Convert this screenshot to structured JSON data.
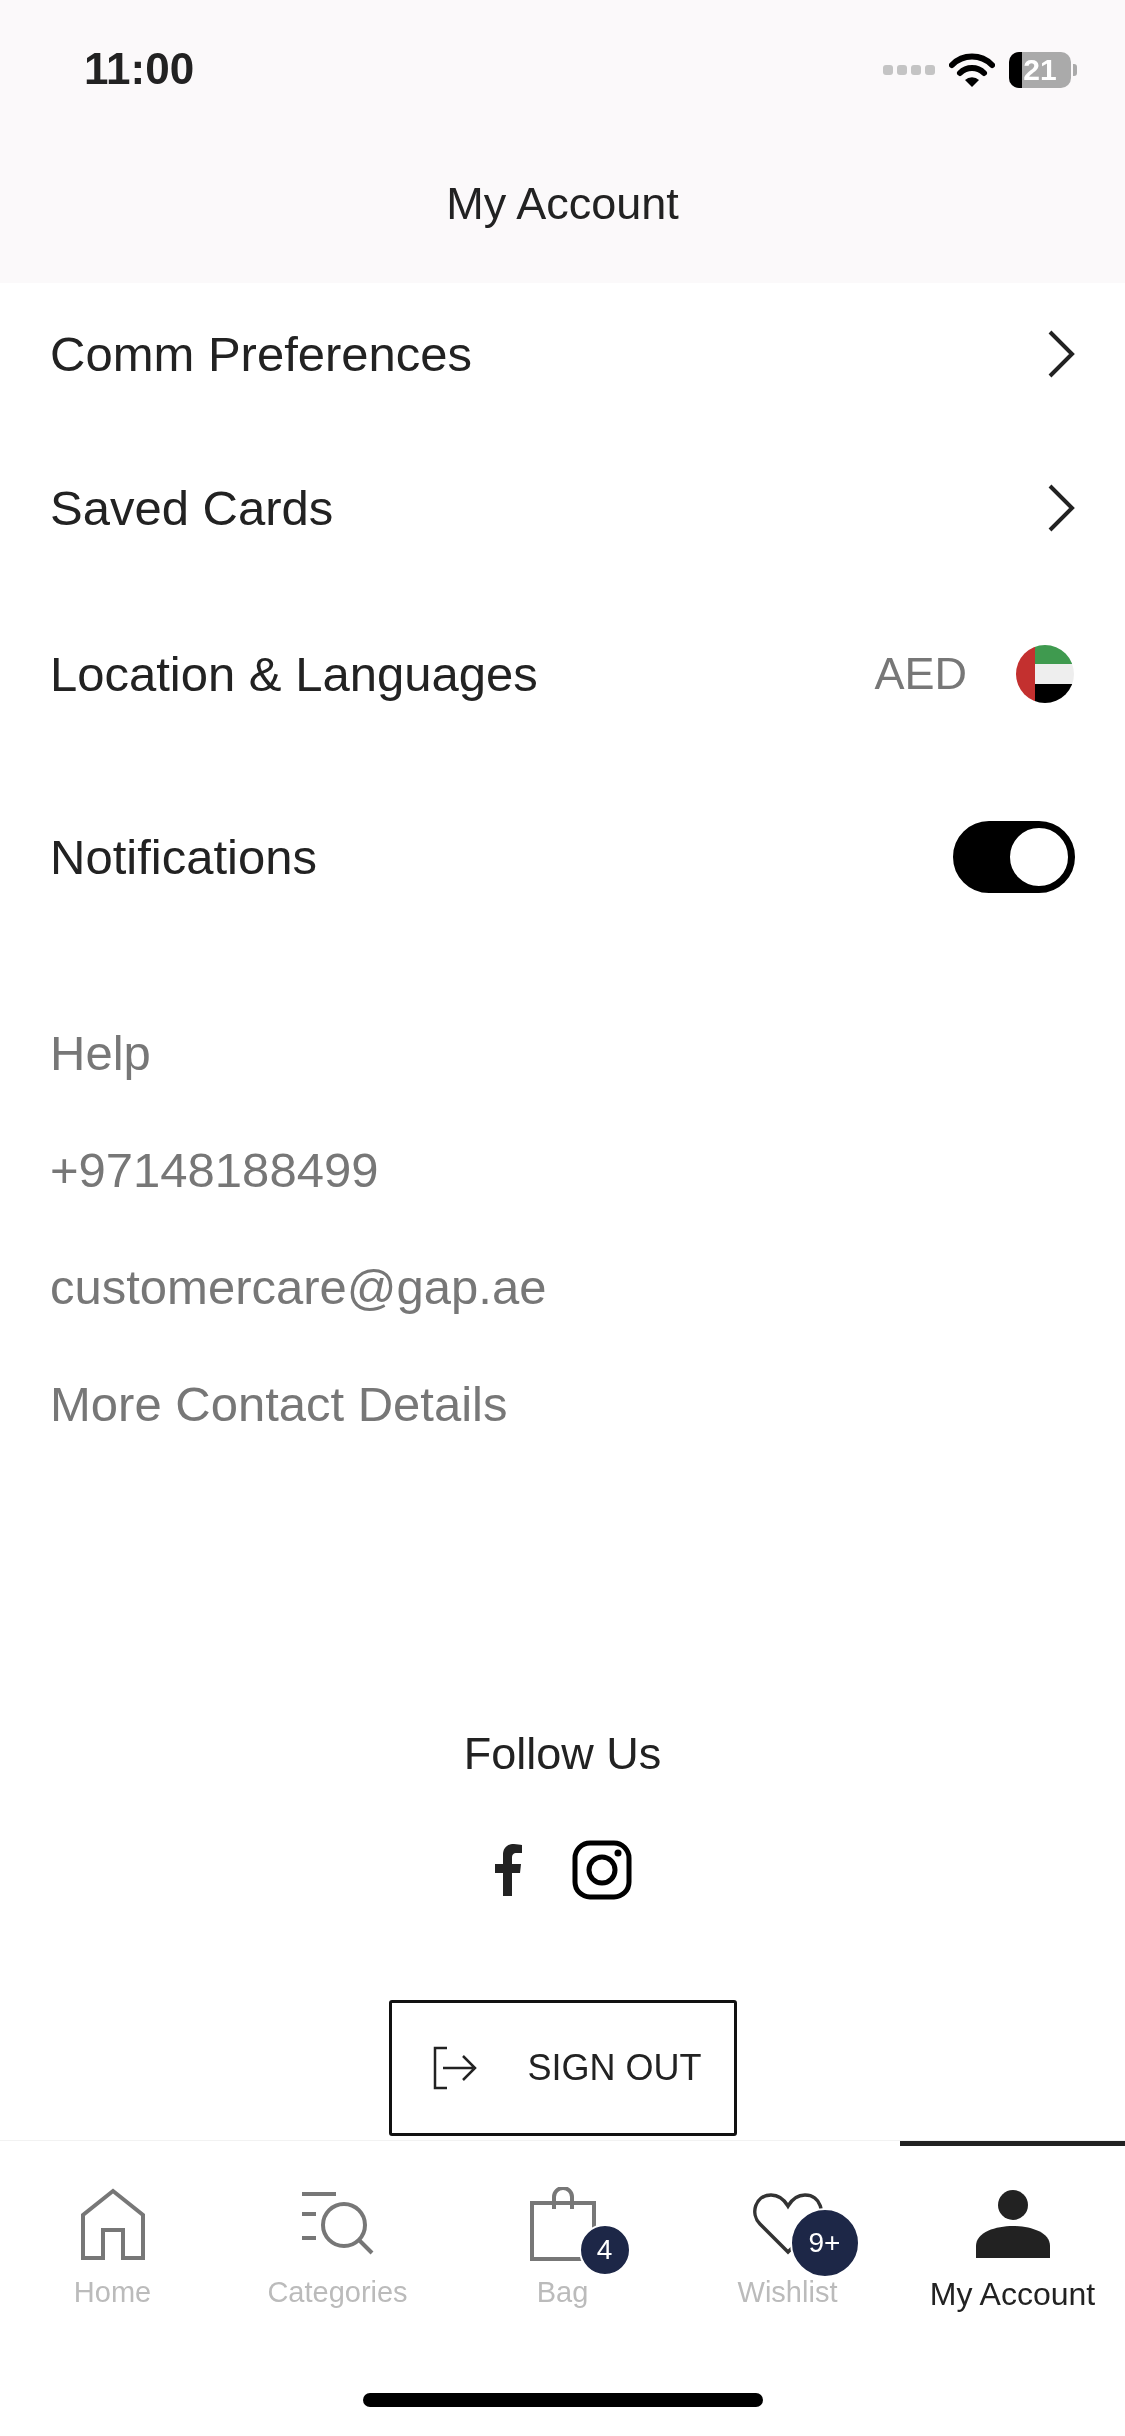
{
  "status_bar": {
    "time": "11:00",
    "battery": "21"
  },
  "header": {
    "title": "My Account"
  },
  "settings": [
    {
      "kind": "link",
      "label": "Comm Preferences"
    },
    {
      "kind": "link",
      "label": "Saved Cards"
    },
    {
      "kind": "locale",
      "label": "Location & Languages",
      "currency": "AED"
    },
    {
      "kind": "toggle",
      "label": "Notifications",
      "on": true
    }
  ],
  "help": {
    "title": "Help",
    "links": [
      "+97148188499",
      "customercare@gap.ae",
      "More Contact Details"
    ]
  },
  "follow": {
    "title": "Follow Us"
  },
  "sign_out": {
    "label": "SIGN OUT"
  },
  "tabs": [
    {
      "label": "Home",
      "selected": false
    },
    {
      "label": "Categories",
      "selected": false
    },
    {
      "label": "Bag",
      "selected": false,
      "badge": "4"
    },
    {
      "label": "Wishlist",
      "selected": false,
      "badge": "9+"
    },
    {
      "label": "My Account",
      "selected": true
    }
  ]
}
